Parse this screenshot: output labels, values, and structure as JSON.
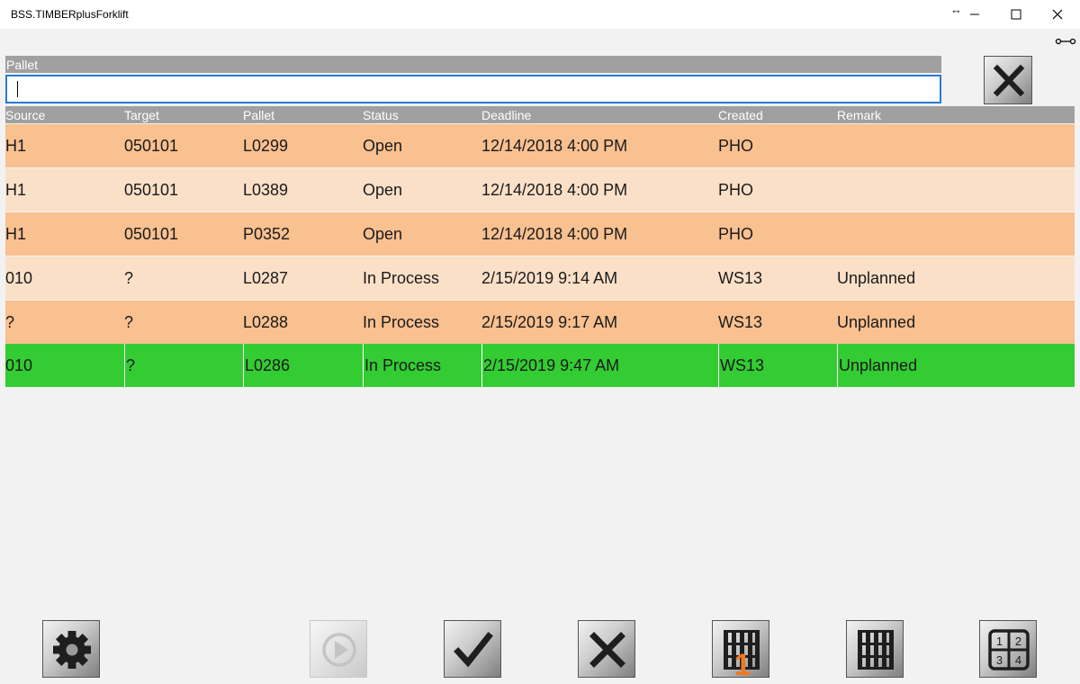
{
  "window": {
    "title": "BSS.TIMBERplusForklift",
    "minimize_glyph": "—",
    "maximize_glyph": "☐",
    "close_glyph": "✕",
    "resize_glyph": "↔"
  },
  "search": {
    "label": "Pallet",
    "value": ""
  },
  "grid": {
    "columns": [
      "Source",
      "Target",
      "Pallet",
      "Status",
      "Deadline",
      "Created",
      "Remark"
    ],
    "rows": [
      {
        "cells": [
          "H1",
          "050101",
          "L0299",
          "Open",
          "12/14/2018 4:00 PM",
          "PHO",
          ""
        ],
        "color": "#f9c090"
      },
      {
        "cells": [
          "H1",
          "050101",
          "L0389",
          "Open",
          "12/14/2018 4:00 PM",
          "PHO",
          ""
        ],
        "color": "#fbe0c8"
      },
      {
        "cells": [
          "H1",
          "050101",
          "P0352",
          "Open",
          "12/14/2018 4:00 PM",
          "PHO",
          ""
        ],
        "color": "#f9c090"
      },
      {
        "cells": [
          "010",
          "?",
          "L0287",
          "In Process",
          "2/15/2019 9:14 AM",
          "WS13",
          "Unplanned"
        ],
        "color": "#fbe0c8"
      },
      {
        "cells": [
          "?",
          "?",
          "L0288",
          "In Process",
          "2/15/2019 9:17 AM",
          "WS13",
          "Unplanned"
        ],
        "color": "#f9c090"
      },
      {
        "cells": [
          "010",
          "?",
          "L0286",
          "In Process",
          "2/15/2019 9:47 AM",
          "WS13",
          "Unplanned"
        ],
        "color": "#33cc33",
        "selected": true
      }
    ]
  },
  "toolbar": {
    "buttons": [
      {
        "name": "settings-button",
        "icon": "gear-icon",
        "enabled": true
      },
      {
        "name": "start-button",
        "icon": "play-icon",
        "enabled": false
      },
      {
        "name": "confirm-button",
        "icon": "checkmark-icon",
        "enabled": true
      },
      {
        "name": "cancel-button",
        "icon": "x-icon",
        "enabled": true
      },
      {
        "name": "single-pallet-button",
        "icon": "pallet-one-icon",
        "enabled": true,
        "badge": "1"
      },
      {
        "name": "pallet-button",
        "icon": "pallet-icon",
        "enabled": true
      },
      {
        "name": "grid-view-button",
        "icon": "grid-1234-icon",
        "enabled": true,
        "labels": [
          "1",
          "2",
          "3",
          "4"
        ]
      }
    ]
  },
  "colors": {
    "row_orange": "#f9c090",
    "row_peach": "#fbe0c8",
    "row_selected": "#33cc33",
    "header_gray": "#a0a0a0",
    "badge_orange": "#f07820",
    "input_border": "#2a7ad2"
  }
}
